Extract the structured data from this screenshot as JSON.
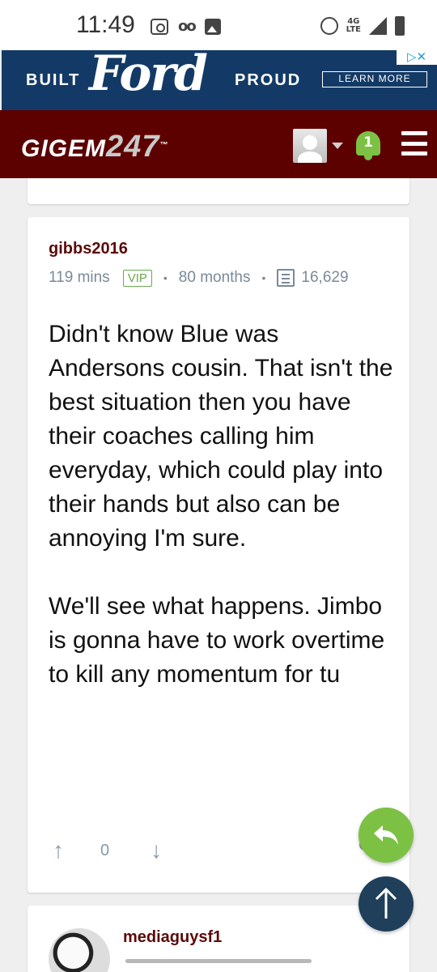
{
  "status_bar": {
    "time": "11:49",
    "network": "4G LTE",
    "icons": [
      "camera-icon",
      "voicemail-icon",
      "image-icon",
      "alarm-icon",
      "signal-icon",
      "battery-icon"
    ]
  },
  "ad": {
    "left_text": "BUILT",
    "brand": "Ford",
    "right_text": "PROUD",
    "cta": "LEARN MORE",
    "choices_icon": "ad-choices-icon",
    "close_icon": "close-icon"
  },
  "header": {
    "logo_text": "GIGEM",
    "logo_number": "247",
    "logo_tm": "™",
    "notification_count": "1",
    "colors": {
      "background": "#5c0000",
      "bell": "#7cc144"
    }
  },
  "post": {
    "username": "gibbs2016",
    "time_ago": "119 mins",
    "badge": "VIP",
    "tenure": "80 months",
    "post_count": "16,629",
    "body": [
      "Didn't know Blue was Andersons cousin. That isn't the best situation then you have their coaches calling him everyday, which could play into their hands but also can be annoying I'm sure.",
      "We'll see what happens. Jimbo is gonna have to work overtime to kill any momentum for tu"
    ],
    "votes": "0",
    "colors": {
      "username": "#5c0a0a",
      "vip": "#6aa84f"
    }
  },
  "next_post": {
    "username": "mediaguysf1"
  },
  "fab": {
    "reply_color": "#7cc144",
    "scroll_top_color": "#1f3f5a"
  }
}
